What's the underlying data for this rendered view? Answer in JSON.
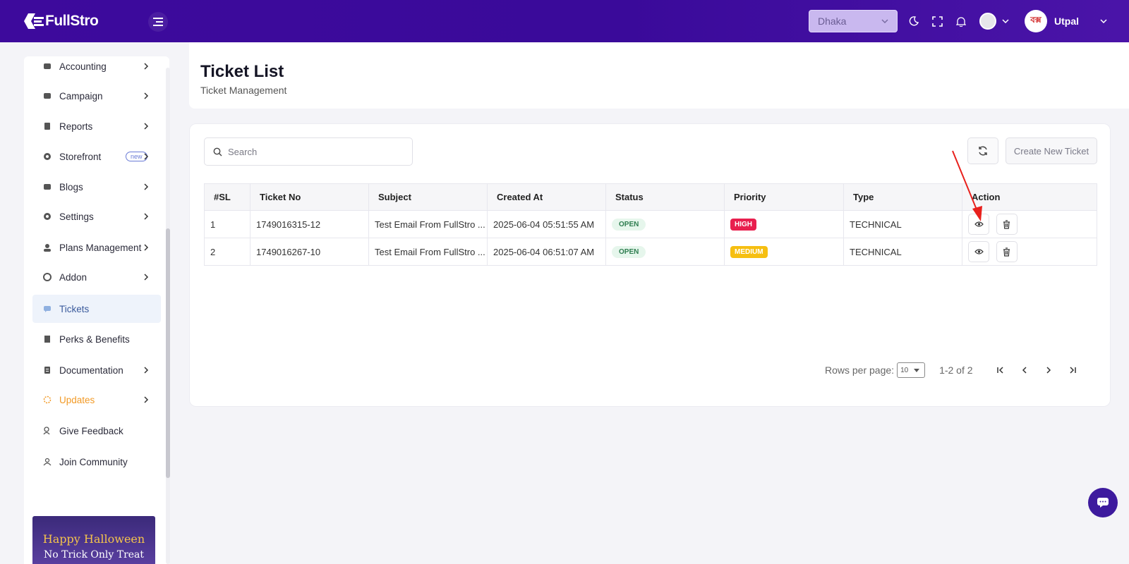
{
  "header": {
    "logo_text": "FullStro",
    "branch_select": "Dhaka",
    "user_name": "Utpal",
    "avatar_text": "বক্স"
  },
  "sidebar": {
    "items": [
      {
        "label": "Accounting",
        "icon": "box-icon",
        "has_chevron": true
      },
      {
        "label": "Campaign",
        "icon": "box-icon",
        "has_chevron": true
      },
      {
        "label": "Reports",
        "icon": "report-icon",
        "has_chevron": true
      },
      {
        "label": "Storefront",
        "icon": "gear-icon",
        "has_chevron": true,
        "badge": "new"
      },
      {
        "label": "Blogs",
        "icon": "box-icon",
        "has_chevron": true
      },
      {
        "label": "Settings",
        "icon": "gear-icon",
        "has_chevron": true
      },
      {
        "label": "Plans Management",
        "icon": "user-icon",
        "has_chevron": true
      },
      {
        "label": "Addon",
        "icon": "plugin-icon",
        "has_chevron": true
      },
      {
        "label": "Tickets",
        "icon": "chat-icon",
        "has_chevron": false,
        "active": true
      },
      {
        "label": "Perks & Benefits",
        "icon": "book-icon",
        "has_chevron": false
      },
      {
        "label": "Documentation",
        "icon": "document-icon",
        "has_chevron": true
      },
      {
        "label": "Updates",
        "icon": "sparkle-icon",
        "has_chevron": true
      },
      {
        "label": "Give Feedback",
        "icon": "feedback-icon",
        "has_chevron": false
      },
      {
        "label": "Join Community",
        "icon": "community-icon",
        "has_chevron": false
      }
    ],
    "promo": {
      "line1": "Happy Halloween",
      "line2": "No Trick Only Treat"
    }
  },
  "page": {
    "title": "Ticket List",
    "subtitle": "Ticket Management"
  },
  "toolbar": {
    "search_placeholder": "Search",
    "create_label": "Create New Ticket"
  },
  "table": {
    "columns": [
      "#SL",
      "Ticket No",
      "Subject",
      "Created At",
      "Status",
      "Priority",
      "Type",
      "Action"
    ],
    "rows": [
      {
        "sl": "1",
        "ticket_no": "1749016315-12",
        "subject": "Test Email From FullStro ...",
        "created_at": "2025-06-04 05:51:55 AM",
        "status": "OPEN",
        "priority": "HIGH",
        "type": "TECHNICAL"
      },
      {
        "sl": "2",
        "ticket_no": "1749016267-10",
        "subject": "Test Email From FullStro ...",
        "created_at": "2025-06-04 06:51:07 AM",
        "status": "OPEN",
        "priority": "MEDIUM",
        "type": "TECHNICAL"
      }
    ]
  },
  "pagination": {
    "rows_per_page_label": "Rows per page:",
    "rows_per_page": "10",
    "range": "1-2 of 2"
  },
  "colors": {
    "header_bg": "#3d0a9c",
    "priority_high": "#e81f4e",
    "priority_medium": "#f6bf11",
    "status_open_bg": "#e6f6ec",
    "updates_text": "#f29a26",
    "annotation_arrow": "#e8201c"
  }
}
